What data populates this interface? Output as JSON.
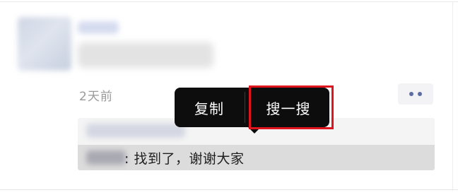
{
  "post": {
    "timestamp": "2天前"
  },
  "reply": {
    "text": ": 找到了，谢谢大家"
  },
  "context_menu": {
    "copy_label": "复制",
    "search_label": "搜一搜"
  },
  "icons": {
    "more": "more-dots-icon",
    "arrow": "popup-arrow"
  },
  "colors": {
    "highlight": "#e0141c",
    "popup_bg": "#0d0d0d",
    "dots": "#5d6ca3"
  }
}
